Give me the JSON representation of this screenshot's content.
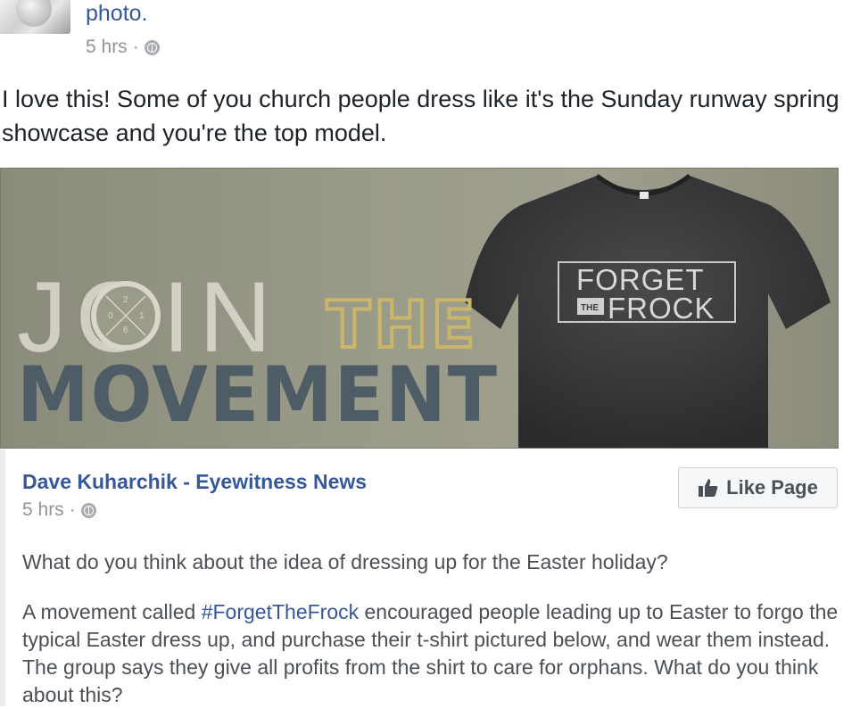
{
  "header": {
    "link_text": "photo.",
    "time": "5 hrs",
    "separator": "·",
    "privacy_icon": "globe-icon"
  },
  "post": {
    "text": "I love this! Some of you church people dress like it's the Sunday runway spring showcase and you're the top model."
  },
  "banner": {
    "join": "JOIN",
    "the": "THE",
    "movement": "MOVEMENT",
    "shirt_logo": {
      "line1": "FORGET",
      "the": "THE",
      "line2": "FROCK"
    },
    "circle_numbers": [
      "2",
      "0",
      "1",
      "6"
    ]
  },
  "shared_post": {
    "page_name": "Dave Kuharchik - Eyewitness News",
    "time": "5 hrs",
    "separator": "·",
    "privacy_icon": "globe-icon",
    "like_button": {
      "label": "Like Page",
      "icon": "thumbs-up-icon"
    },
    "question": "What do you think about the idea of dressing up for the Easter holiday?",
    "body_before": "A movement called ",
    "hashtag": "#ForgetTheFrock",
    "body_after": " encouraged people leading up to Easter to forgo the typical Easter dress up, and purchase their t-shirt pictured below, and wear them instead. The group says they give all profits from the shirt to care for orphans. What do you think about this?"
  },
  "colors": {
    "link": "#365899",
    "meta": "#90949c",
    "body_text": "#1d2129",
    "shared_text": "#4b4f56",
    "movement_text": "#4e5c66",
    "the_text": "#c9b66a",
    "join_text": "#d9d7cc",
    "shirt": "#3a3a3c"
  }
}
